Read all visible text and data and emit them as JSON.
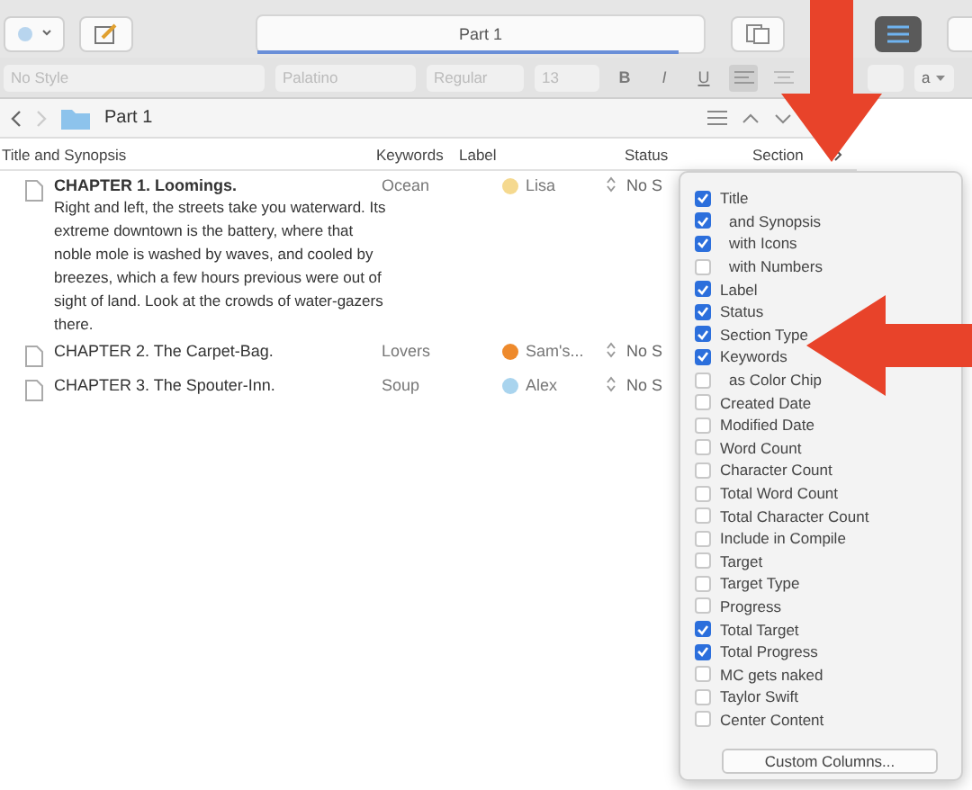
{
  "toolbar": {
    "document_tab": "Part 1"
  },
  "format_bar": {
    "style": "No Style",
    "font": "Palatino",
    "weight": "Regular",
    "size": "13",
    "bold": "B",
    "italic": "I",
    "underline": "U",
    "text_color": "a"
  },
  "header": {
    "title": "Part 1"
  },
  "columns": [
    "Title and Synopsis",
    "Keywords",
    "Label",
    "Status",
    "Section"
  ],
  "rows": [
    {
      "title": "CHAPTER 1. Loomings.",
      "synopsis": "Right and left, the streets take you waterward. Its extreme downtown is the battery, where that noble mole is washed by waves, and cooled by breezes, which a few hours previous were out of sight of land. Look at the crowds of water-gazers there.",
      "keyword": "Ocean",
      "label": "Lisa",
      "color": "#f5d98f",
      "status": "No S"
    },
    {
      "title": "CHAPTER 2. The Carpet-Bag.",
      "keyword": "Lovers",
      "label": "Sam's...",
      "color": "#ee8a2c",
      "status": "No S"
    },
    {
      "title": "CHAPTER 3. The Spouter-Inn.",
      "keyword": "Soup",
      "label": "Alex",
      "color": "#a9d4ee",
      "status": "No S"
    }
  ],
  "column_menu": {
    "items": [
      {
        "label": "Title",
        "checked": true,
        "indented": false
      },
      {
        "label": "and Synopsis",
        "checked": true,
        "indented": true
      },
      {
        "label": "with Icons",
        "checked": true,
        "indented": true
      },
      {
        "label": "with Numbers",
        "checked": false,
        "indented": true
      },
      {
        "label": "Label",
        "checked": true,
        "indented": false
      },
      {
        "label": "Status",
        "checked": true,
        "indented": false
      },
      {
        "label": "Section Type",
        "checked": true,
        "indented": false
      },
      {
        "label": "Keywords",
        "checked": true,
        "indented": false
      },
      {
        "label": "as Color Chip",
        "checked": false,
        "indented": true
      },
      {
        "label": "Created Date",
        "checked": false,
        "indented": false
      },
      {
        "label": "Modified Date",
        "checked": false,
        "indented": false
      },
      {
        "label": "Word Count",
        "checked": false,
        "indented": false
      },
      {
        "label": "Character Count",
        "checked": false,
        "indented": false
      },
      {
        "label": "Total Word Count",
        "checked": false,
        "indented": false
      },
      {
        "label": "Total Character Count",
        "checked": false,
        "indented": false
      },
      {
        "label": "Include in Compile",
        "checked": false,
        "indented": false
      },
      {
        "label": "Target",
        "checked": false,
        "indented": false
      },
      {
        "label": "Target Type",
        "checked": false,
        "indented": false
      },
      {
        "label": "Progress",
        "checked": false,
        "indented": false
      },
      {
        "label": "Total Target",
        "checked": true,
        "indented": false
      },
      {
        "label": "Total Progress",
        "checked": true,
        "indented": false
      },
      {
        "label": "MC gets naked",
        "checked": false,
        "indented": false
      },
      {
        "label": "Taylor Swift",
        "checked": false,
        "indented": false
      },
      {
        "label": "Center Content",
        "checked": false,
        "indented": false
      }
    ],
    "button": "Custom Columns..."
  }
}
